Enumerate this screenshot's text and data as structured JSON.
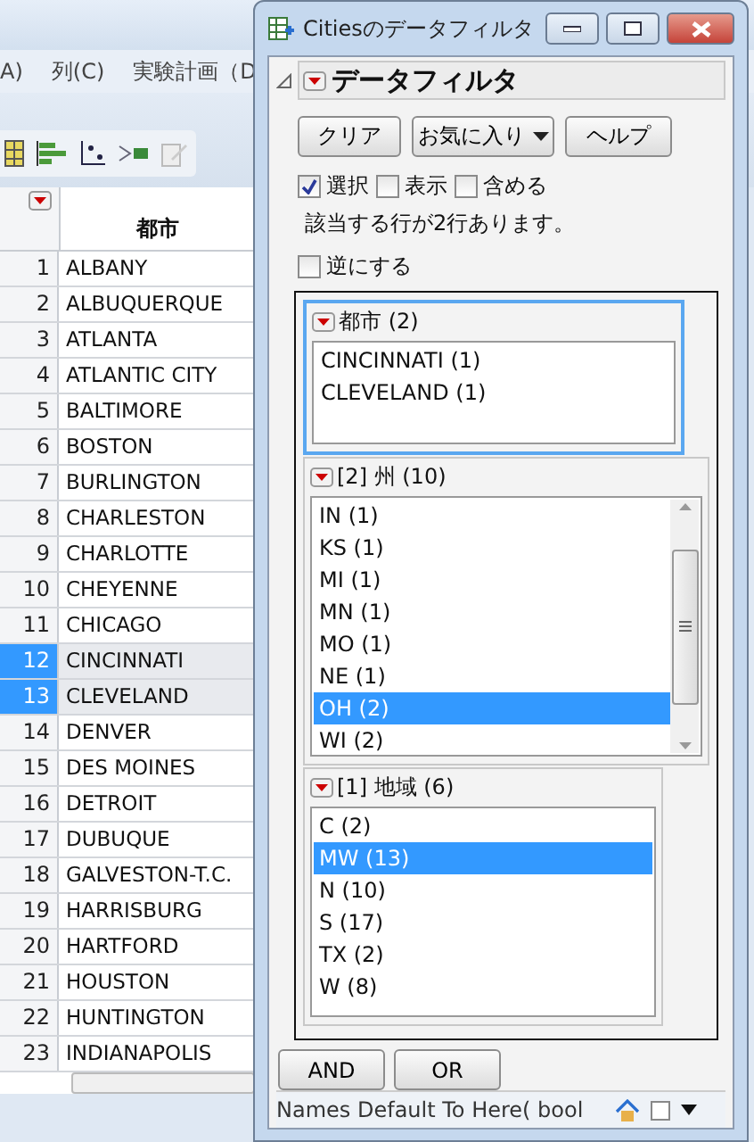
{
  "app": {
    "menu": [
      "A)",
      "列(C)",
      "実験計画（D"
    ],
    "table": {
      "header": "都市",
      "rows": [
        {
          "n": "1",
          "city": "ALBANY",
          "selected": false
        },
        {
          "n": "2",
          "city": "ALBUQUERQUE",
          "selected": false
        },
        {
          "n": "3",
          "city": "ATLANTA",
          "selected": false
        },
        {
          "n": "4",
          "city": "ATLANTIC CITY",
          "selected": false
        },
        {
          "n": "5",
          "city": "BALTIMORE",
          "selected": false
        },
        {
          "n": "6",
          "city": "BOSTON",
          "selected": false
        },
        {
          "n": "7",
          "city": "BURLINGTON",
          "selected": false
        },
        {
          "n": "8",
          "city": "CHARLESTON",
          "selected": false
        },
        {
          "n": "9",
          "city": "CHARLOTTE",
          "selected": false
        },
        {
          "n": "10",
          "city": "CHEYENNE",
          "selected": false
        },
        {
          "n": "11",
          "city": "CHICAGO",
          "selected": false
        },
        {
          "n": "12",
          "city": "CINCINNATI",
          "selected": true
        },
        {
          "n": "13",
          "city": "CLEVELAND",
          "selected": true
        },
        {
          "n": "14",
          "city": "DENVER",
          "selected": false
        },
        {
          "n": "15",
          "city": "DES MOINES",
          "selected": false
        },
        {
          "n": "16",
          "city": "DETROIT",
          "selected": false
        },
        {
          "n": "17",
          "city": "DUBUQUE",
          "selected": false
        },
        {
          "n": "18",
          "city": "GALVESTON-T.C.",
          "selected": false
        },
        {
          "n": "19",
          "city": "HARRISBURG",
          "selected": false
        },
        {
          "n": "20",
          "city": "HARTFORD",
          "selected": false
        },
        {
          "n": "21",
          "city": "HOUSTON",
          "selected": false
        },
        {
          "n": "22",
          "city": "HUNTINGTON",
          "selected": false
        },
        {
          "n": "23",
          "city": "INDIANAPOLIS",
          "selected": false
        }
      ]
    }
  },
  "dialog": {
    "title": "Citiesのデータフィルタ",
    "outline_title": "データフィルタ",
    "buttons": [
      {
        "label": "クリア",
        "kind": "plain"
      },
      {
        "label": "お気に入り",
        "kind": "dropdown"
      },
      {
        "label": "ヘルプ",
        "kind": "plain"
      }
    ],
    "modes": [
      {
        "label": "選択",
        "checked": true
      },
      {
        "label": "表示",
        "checked": false
      },
      {
        "label": "含める",
        "checked": false
      }
    ],
    "match_text": "該当する行が2行あります。",
    "invert": {
      "label": "逆にする",
      "checked": false
    },
    "filters": [
      {
        "title": "都市 (2)",
        "focused": true,
        "scrollbar": false,
        "items": [
          {
            "label": "CINCINNATI (1)",
            "selected": false
          },
          {
            "label": "CLEVELAND (1)",
            "selected": false
          }
        ]
      },
      {
        "title": "[2] 州 (10)",
        "focused": false,
        "scrollbar": true,
        "items": [
          {
            "label": "IN (1)",
            "selected": false
          },
          {
            "label": "KS (1)",
            "selected": false
          },
          {
            "label": "MI (1)",
            "selected": false
          },
          {
            "label": "MN (1)",
            "selected": false
          },
          {
            "label": "MO (1)",
            "selected": false
          },
          {
            "label": "NE (1)",
            "selected": false
          },
          {
            "label": "OH (2)",
            "selected": true
          },
          {
            "label": "WI (2)",
            "selected": false
          }
        ]
      },
      {
        "title": "[1] 地域 (6)",
        "focused": false,
        "scrollbar": false,
        "items": [
          {
            "label": "C (2)",
            "selected": false
          },
          {
            "label": "MW (13)",
            "selected": true
          },
          {
            "label": "N (10)",
            "selected": false
          },
          {
            "label": "S (17)",
            "selected": false
          },
          {
            "label": "TX (2)",
            "selected": false
          },
          {
            "label": "W (8)",
            "selected": false
          }
        ]
      }
    ],
    "logic_buttons": [
      "AND",
      "OR"
    ],
    "status_text": "Names Default To Here( bool"
  }
}
